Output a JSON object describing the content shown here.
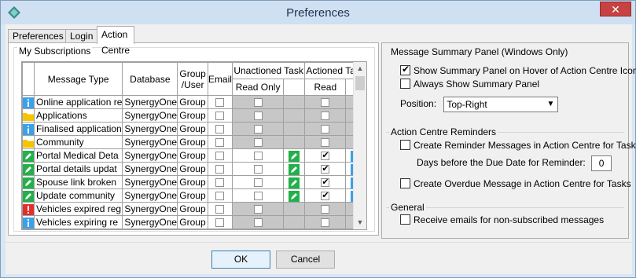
{
  "window": {
    "title": "Preferences",
    "close_glyph": "✕"
  },
  "tabs": [
    {
      "label": "Preferences"
    },
    {
      "label": "Login"
    },
    {
      "label": "Action Centre"
    }
  ],
  "subscriptions": {
    "title": "My Subscriptions",
    "headers": {
      "message_type": "Message Type",
      "database": "Database",
      "group_user": "Group /User",
      "email": "Email",
      "unactioned_task": "Unactioned Task",
      "actioned_task": "Actioned Task",
      "read_only": "Read Only",
      "read": "Read"
    },
    "rows": [
      {
        "icon": "info-icon",
        "name": "Online application re",
        "database": "SynergyOne",
        "group": "Group",
        "email": false,
        "unactioned_read_only": false,
        "unactioned_icon": "",
        "actioned_read": false,
        "actioned_icon": "",
        "greyed": true
      },
      {
        "icon": "folder-icon",
        "name": "Applications",
        "database": "SynergyOne",
        "group": "Group",
        "email": false,
        "unactioned_read_only": false,
        "unactioned_icon": "",
        "actioned_read": false,
        "actioned_icon": "",
        "greyed": true
      },
      {
        "icon": "info-icon",
        "name": "Finalised application",
        "database": "SynergyOne",
        "group": "Group",
        "email": false,
        "unactioned_read_only": false,
        "unactioned_icon": "",
        "actioned_read": false,
        "actioned_icon": "",
        "greyed": true
      },
      {
        "icon": "folder-icon",
        "name": "Community",
        "database": "SynergyOne",
        "group": "Group",
        "email": false,
        "unactioned_read_only": false,
        "unactioned_icon": "",
        "actioned_read": false,
        "actioned_icon": "",
        "greyed": true
      },
      {
        "icon": "pencil-icon",
        "name": "Portal Medical Deta",
        "database": "SynergyOne",
        "group": "Group",
        "email": false,
        "unactioned_read_only": false,
        "unactioned_icon": "pencil-icon",
        "actioned_read": true,
        "actioned_icon": "info-icon",
        "greyed": false
      },
      {
        "icon": "pencil-icon",
        "name": "Portal details updat",
        "database": "SynergyOne",
        "group": "Group",
        "email": false,
        "unactioned_read_only": false,
        "unactioned_icon": "pencil-icon",
        "actioned_read": true,
        "actioned_icon": "info-icon",
        "greyed": false
      },
      {
        "icon": "pencil-icon",
        "name": "Spouse link broken",
        "database": "SynergyOne",
        "group": "Group",
        "email": false,
        "unactioned_read_only": false,
        "unactioned_icon": "pencil-icon",
        "actioned_read": true,
        "actioned_icon": "info-icon",
        "greyed": false
      },
      {
        "icon": "pencil-icon",
        "name": "Update community",
        "database": "SynergyOne",
        "group": "Group",
        "email": false,
        "unactioned_read_only": false,
        "unactioned_icon": "pencil-icon",
        "actioned_read": true,
        "actioned_icon": "info-icon",
        "greyed": false
      },
      {
        "icon": "alert-icon",
        "name": "Vehicles expired reg",
        "database": "SynergyOne",
        "group": "Group",
        "email": false,
        "unactioned_read_only": false,
        "unactioned_icon": "",
        "actioned_read": false,
        "actioned_icon": "",
        "greyed": true
      },
      {
        "icon": "info-icon",
        "name": "Vehicles expiring re",
        "database": "SynergyOne",
        "group": "Group",
        "email": false,
        "unactioned_read_only": false,
        "unactioned_icon": "",
        "actioned_read": false,
        "actioned_icon": "",
        "greyed": true
      }
    ]
  },
  "summary_panel": {
    "title": "Message Summary Panel (Windows Only)",
    "show_on_hover_label": "Show Summary Panel on Hover of Action Centre Icon",
    "show_on_hover": true,
    "always_show_label": "Always Show Summary Panel",
    "always_show": false,
    "position_label": "Position:",
    "position_value": "Top-Right"
  },
  "reminders": {
    "title": "Action Centre Reminders",
    "create_reminder_label": "Create Reminder Messages in Action Centre for Tasks",
    "create_reminder": false,
    "days_label": "Days before the Due Date for Reminder:",
    "days_value": "0",
    "create_overdue_label": "Create Overdue Message in Action Centre for Tasks",
    "create_overdue": false
  },
  "general": {
    "title": "General",
    "receive_emails_label": "Receive emails for non-subscribed messages",
    "receive_emails": false
  },
  "buttons": {
    "ok": "OK",
    "cancel": "Cancel"
  },
  "colors": {
    "info": "#3aa0e8",
    "folder": "#f5c400",
    "pencil": "#22b04a",
    "alert": "#e0302a"
  }
}
